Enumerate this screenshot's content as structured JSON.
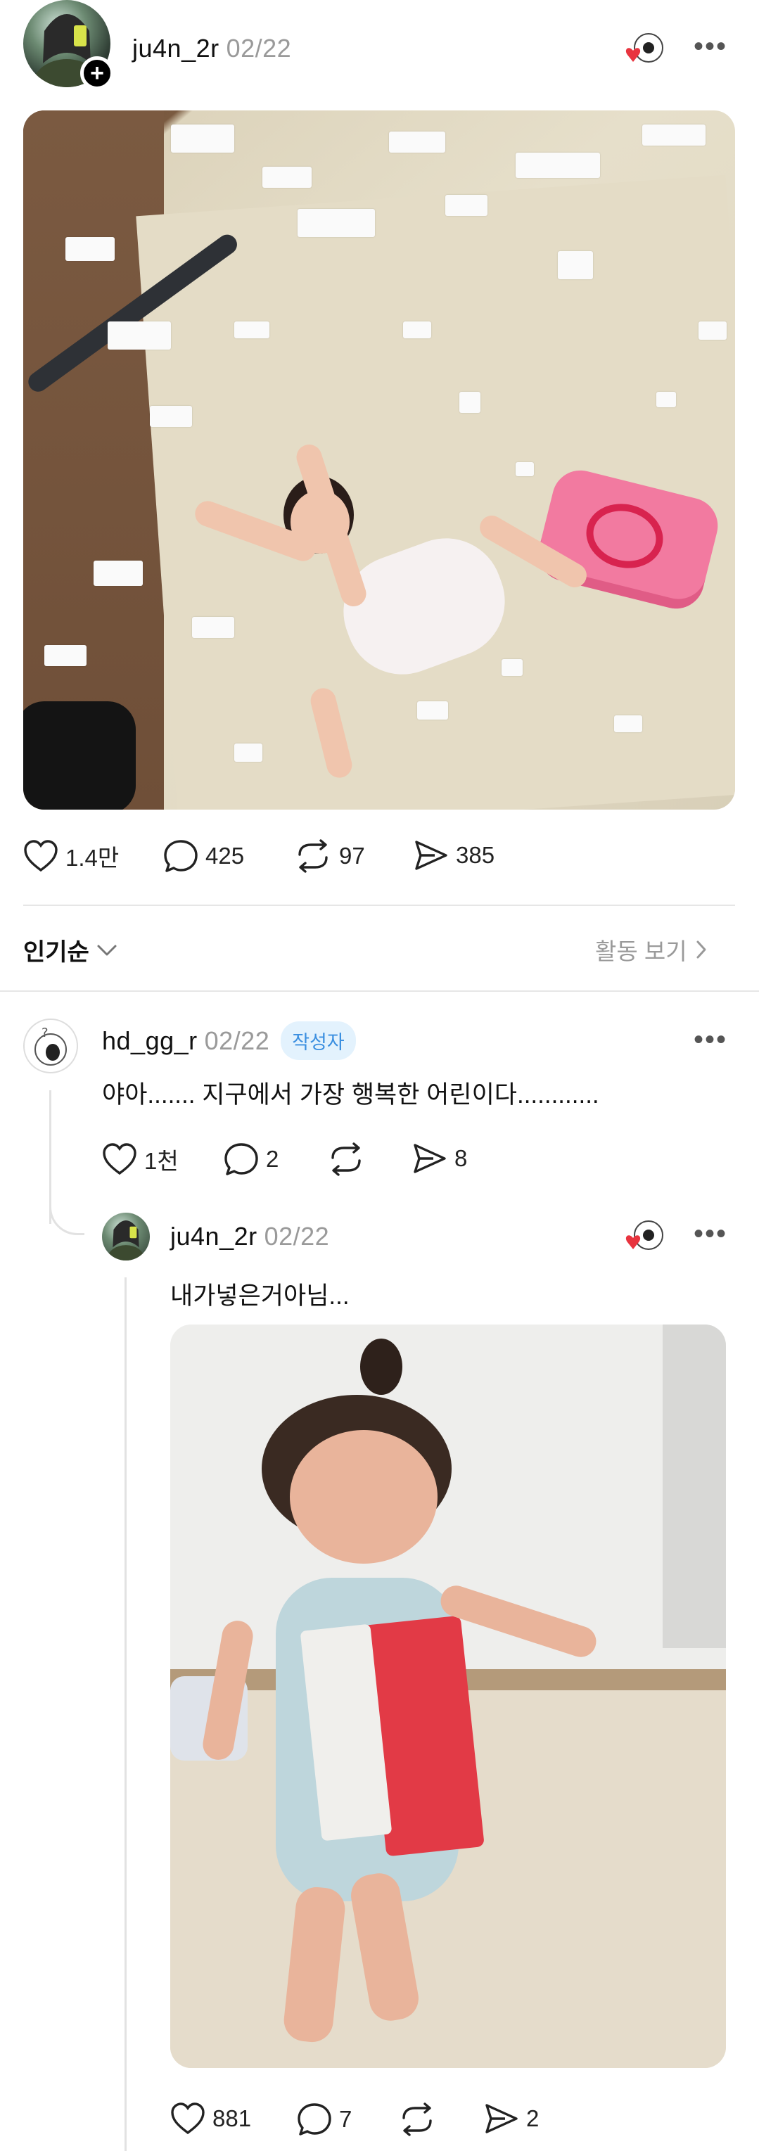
{
  "post": {
    "username": "ju4n_2r",
    "date": "02/22",
    "more_label": "•••",
    "avatar_add_label": "+",
    "stats": {
      "likes": "1.4만",
      "comments": "425",
      "reposts": "97",
      "shares": "385"
    }
  },
  "sort": {
    "label": "인기순",
    "activity_label": "활동 보기"
  },
  "comments": [
    {
      "username": "hd_gg_r",
      "date": "02/22",
      "badge": "작성자",
      "text": "야아....... 지구에서 가장 행복한 어린이다............",
      "likes": "1천",
      "comments": "2",
      "shares": "8",
      "more_label": "•••"
    },
    {
      "username": "ju4n_2r",
      "date": "02/22",
      "text": "내가넣은거아님...",
      "likes": "881",
      "comments": "7",
      "shares": "2",
      "more_label": "•••"
    }
  ],
  "colors": {
    "accent_blue": "#3b8fe0",
    "heart_red": "#e8343f",
    "muted": "#9a9a9a"
  }
}
